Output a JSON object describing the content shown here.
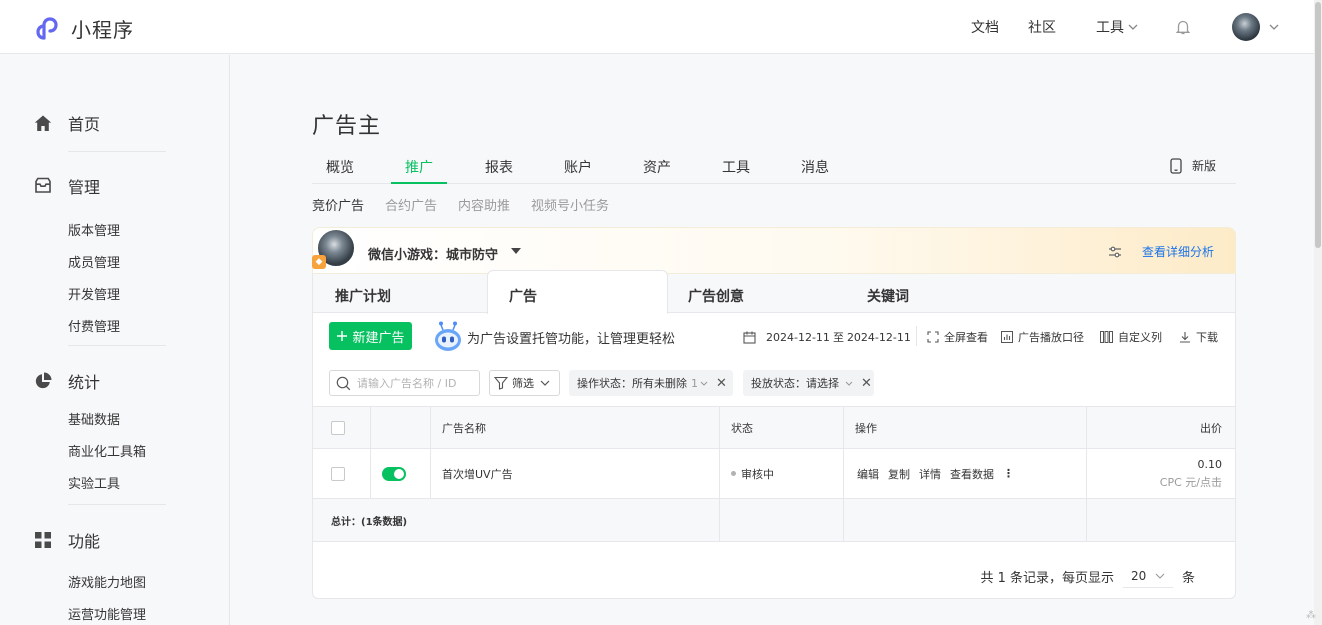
{
  "topbar": {
    "brand": "小程序",
    "nav": [
      "文档",
      "社区"
    ],
    "tools_label": "工具"
  },
  "sidebar": {
    "groups": [
      {
        "title": "首页",
        "items": []
      },
      {
        "title": "管理",
        "items": [
          "版本管理",
          "成员管理",
          "开发管理",
          "付费管理"
        ]
      },
      {
        "title": "统计",
        "items": [
          "基础数据",
          "商业化工具箱",
          "实验工具"
        ]
      },
      {
        "title": "功能",
        "items": [
          "游戏能力地图",
          "运营功能管理"
        ]
      }
    ]
  },
  "main": {
    "page_title": "广告主",
    "tabs": [
      "概览",
      "推广",
      "报表",
      "账户",
      "资产",
      "工具",
      "消息"
    ],
    "active_tab": "推广",
    "new_version": "新版",
    "subtabs": [
      "竞价广告",
      "合约广告",
      "内容助推",
      "视频号小任务"
    ],
    "account": {
      "name": "微信小游戏：城市防守",
      "detail_link": "查看详细分析"
    },
    "panel_tabs": [
      "推广计划",
      "广告",
      "广告创意",
      "关键词"
    ],
    "toolbar": {
      "new_button": "新建广告",
      "promo": "为广告设置托管功能，让管理更轻松",
      "date_start": "2024-12-11",
      "date_sep": "至",
      "date_end": "2024-12-11",
      "fullscreen": "全屏查看",
      "caliber": "广告播放口径",
      "custom_cols": "自定义列",
      "download": "下载"
    },
    "filters": {
      "search_placeholder": "请输入广告名称 / ID",
      "filter_label": "筛选",
      "op_status": "操作状态：所有未删除",
      "op_status_count": "1",
      "delivery_status": "投放状态：请选择"
    },
    "table": {
      "headers": {
        "name": "广告名称",
        "status": "状态",
        "ops": "操作",
        "bid": "出价"
      },
      "rows": [
        {
          "name": "首次增UV广告",
          "status": "审核中",
          "ops": [
            "编辑",
            "复制",
            "详情",
            "查看数据"
          ],
          "bid": "0.10",
          "bid_unit": "CPC 元/点击"
        }
      ],
      "total": "总计：(1条数据)"
    },
    "pager": {
      "prefix": "共 1 条记录，每页显示",
      "page_size": "20",
      "suffix": "条"
    }
  },
  "colors": {
    "accent": "#07c160",
    "link": "#1a73e8"
  }
}
